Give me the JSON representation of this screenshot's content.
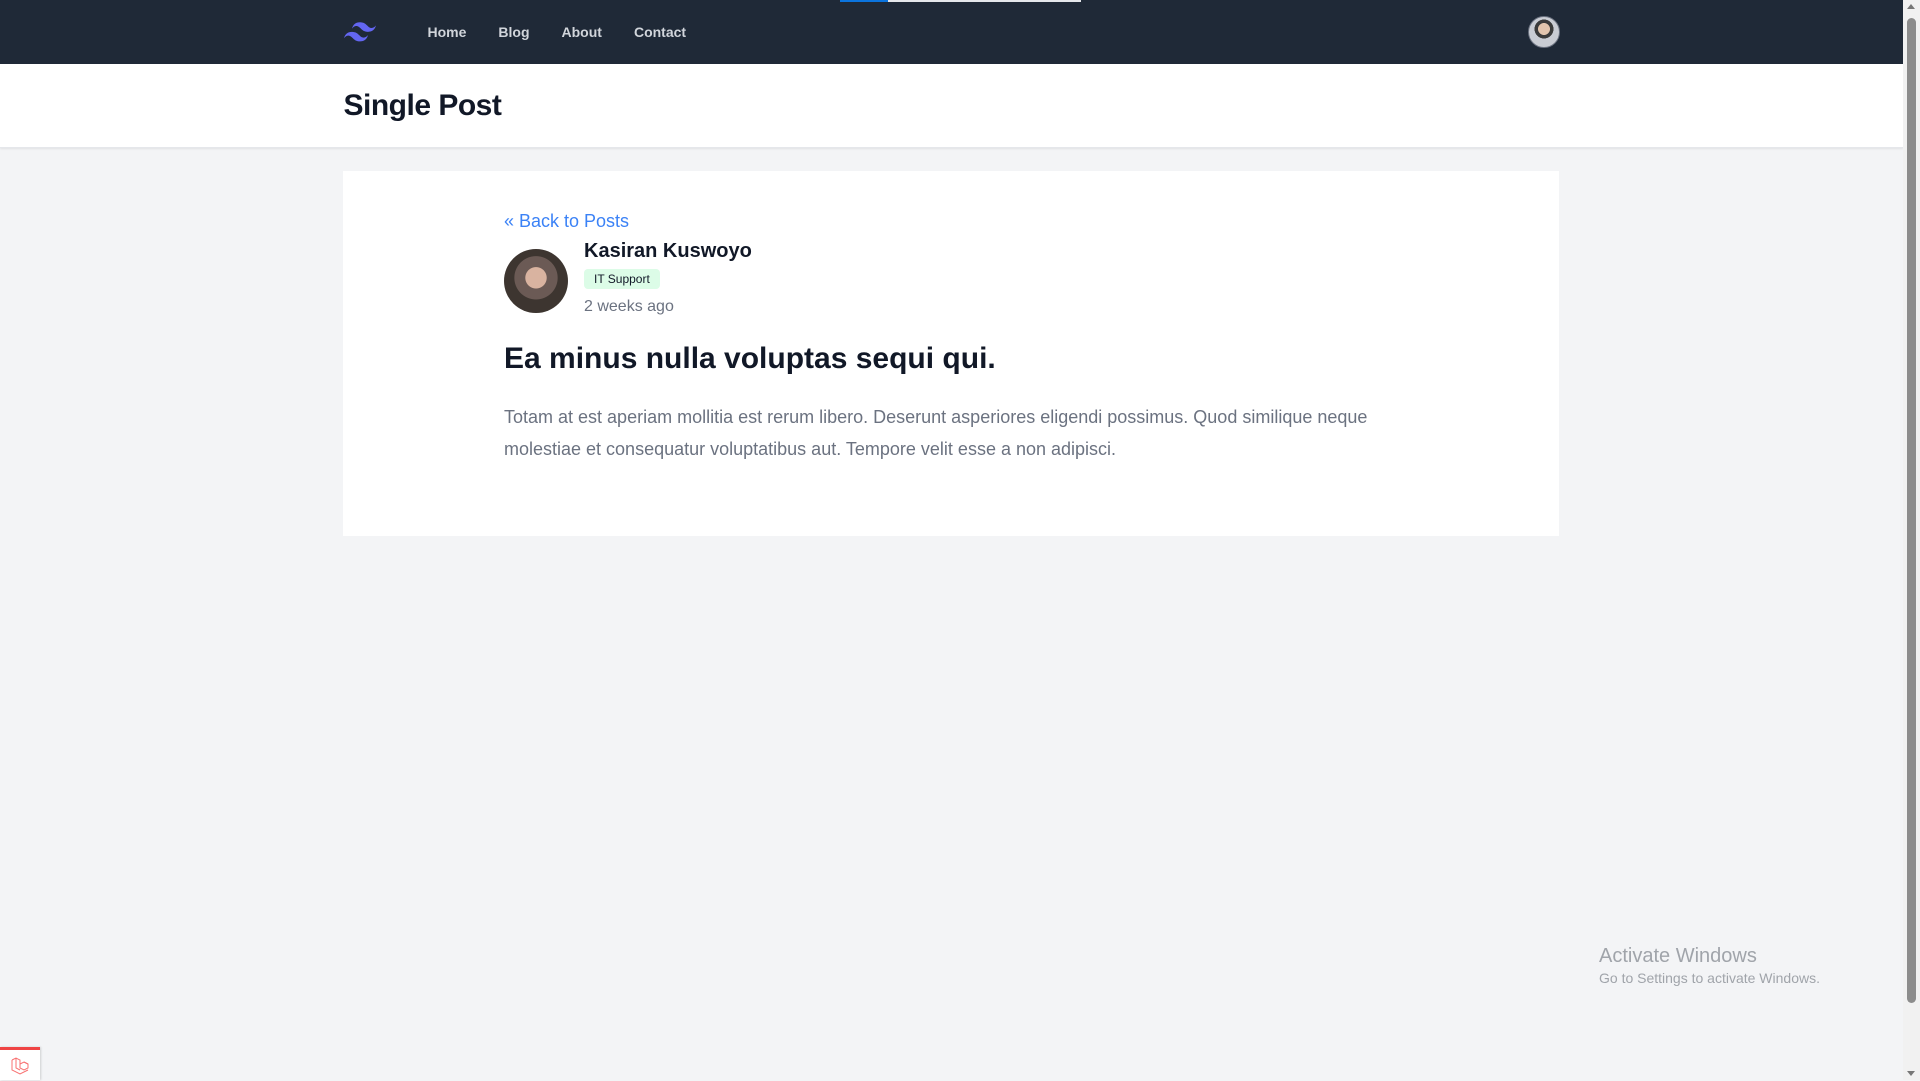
{
  "nav": {
    "links": [
      "Home",
      "Blog",
      "About",
      "Contact"
    ]
  },
  "header": {
    "title": "Single Post"
  },
  "post": {
    "back_link": "« Back to Posts",
    "author": "Kasiran Kuswoyo",
    "category": "IT Support",
    "time": "2 weeks ago",
    "title": "Ea minus nulla voluptas sequi qui.",
    "body": "Totam at est aperiam mollitia est rerum libero. Deserunt asperiores eligendi possimus. Quod similique neque molestiae et consequatur voluptatibus aut. Tempore velit esse a non adipisci."
  },
  "watermark": {
    "title": "Activate Windows",
    "subtitle": "Go to Settings to activate Windows."
  },
  "colors": {
    "nav_bg": "#1f2937",
    "link": "#3b82f6",
    "badge_bg": "#dcfce7",
    "logo": "#6366f1"
  }
}
